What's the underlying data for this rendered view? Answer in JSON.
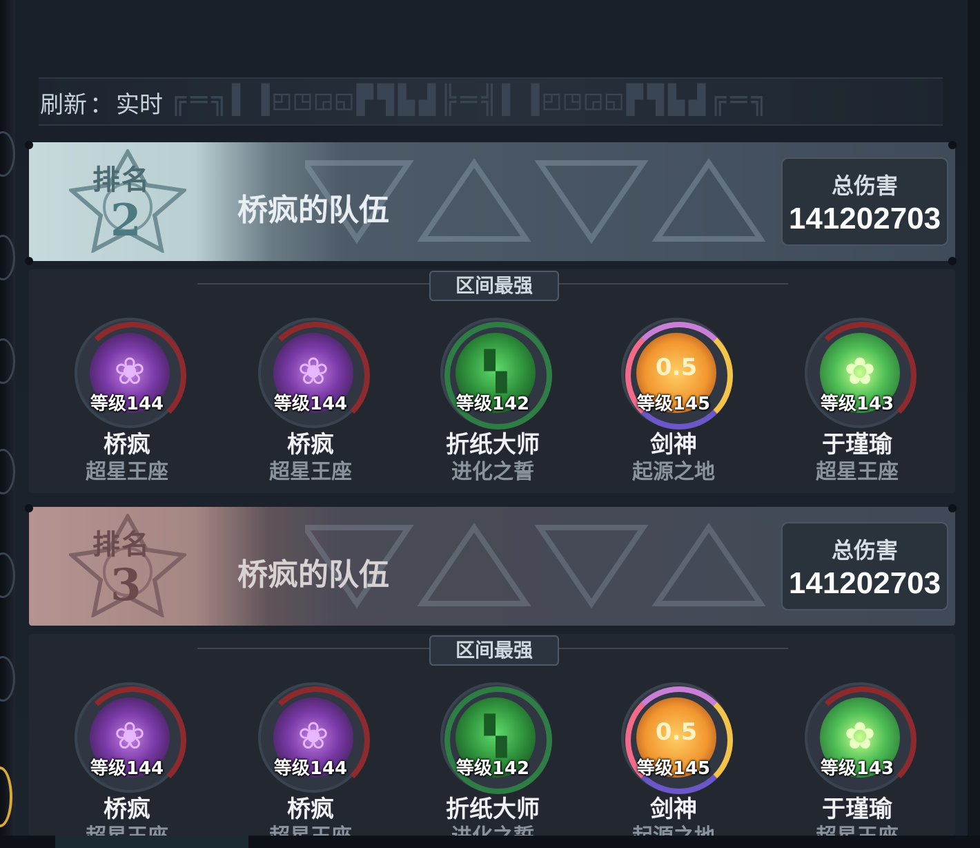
{
  "refresh": {
    "label": "刷新",
    "separator": "：",
    "value": "实时"
  },
  "ranks": [
    {
      "rank_label": "排名",
      "rank_number": "2",
      "theme": "silver",
      "team_name": "桥疯的队伍",
      "damage_label": "总伤害",
      "damage_value": "141202703",
      "section_title": "区间最强",
      "members": [
        {
          "avatar": "rose-icon",
          "level": "等级144",
          "name": "桥疯",
          "server": "超星王座"
        },
        {
          "avatar": "rose-icon",
          "level": "等级144",
          "name": "桥疯",
          "server": "超星王座"
        },
        {
          "avatar": "creeper-icon",
          "level": "等级142",
          "name": "折纸大师",
          "server": "进化之誓"
        },
        {
          "avatar": "cake-icon",
          "level": "等级145",
          "name": "剑神",
          "server": "起源之地"
        },
        {
          "avatar": "flower-icon",
          "level": "等级143",
          "name": "于瑾瑜",
          "server": "超星王座"
        }
      ]
    },
    {
      "rank_label": "排名",
      "rank_number": "3",
      "theme": "bronze",
      "team_name": "桥疯的队伍",
      "damage_label": "总伤害",
      "damage_value": "141202703",
      "section_title": "区间最强",
      "members": [
        {
          "avatar": "rose-icon",
          "level": "等级144",
          "name": "桥疯",
          "server": "超星王座"
        },
        {
          "avatar": "rose-icon",
          "level": "等级144",
          "name": "桥疯",
          "server": "超星王座"
        },
        {
          "avatar": "creeper-icon",
          "level": "等级142",
          "name": "折纸大师",
          "server": "进化之誓"
        },
        {
          "avatar": "cake-icon",
          "level": "等级145",
          "name": "剑神",
          "server": "起源之地"
        },
        {
          "avatar": "flower-icon",
          "level": "等级143",
          "name": "于瑾瑜",
          "server": "超星王座"
        }
      ]
    }
  ],
  "cake_badge": "0.5",
  "colors": {
    "silver_banner": "#c6d9db",
    "bronze_banner": "#b49491",
    "panel": "#232830",
    "accent_gold": "#d9a93a"
  }
}
